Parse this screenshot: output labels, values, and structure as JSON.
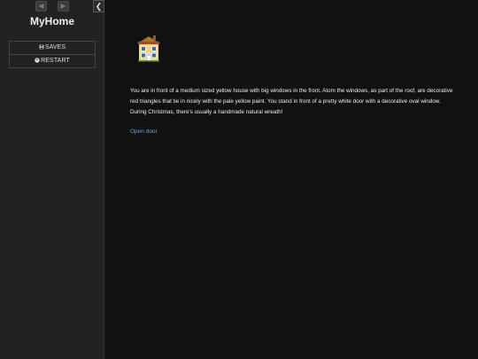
{
  "sidebar": {
    "title": "MyHome",
    "menu": [
      {
        "label": "SAVES",
        "icon": "save-icon"
      },
      {
        "label": "RESTART",
        "icon": "power-icon"
      }
    ],
    "history": {
      "back_icon": "arrow-left-icon",
      "forward_icon": "arrow-right-icon"
    },
    "toggle_icon": "chevron-left-icon"
  },
  "passage": {
    "image_icon": "house-icon",
    "text": "You are in front of a medium sized yellow house with big windows in the front. Atom the windows, as part of the roof, are decorative red triangles that tie in nicely with the pale yellow paint. You stand in front of a pretty white door with a decorative oval window. During Christmas, there's usually a handmade natural wreath!",
    "link": "Open door"
  },
  "colors": {
    "background": "#111111",
    "sidebar": "#222222",
    "link": "#68a0d8"
  }
}
